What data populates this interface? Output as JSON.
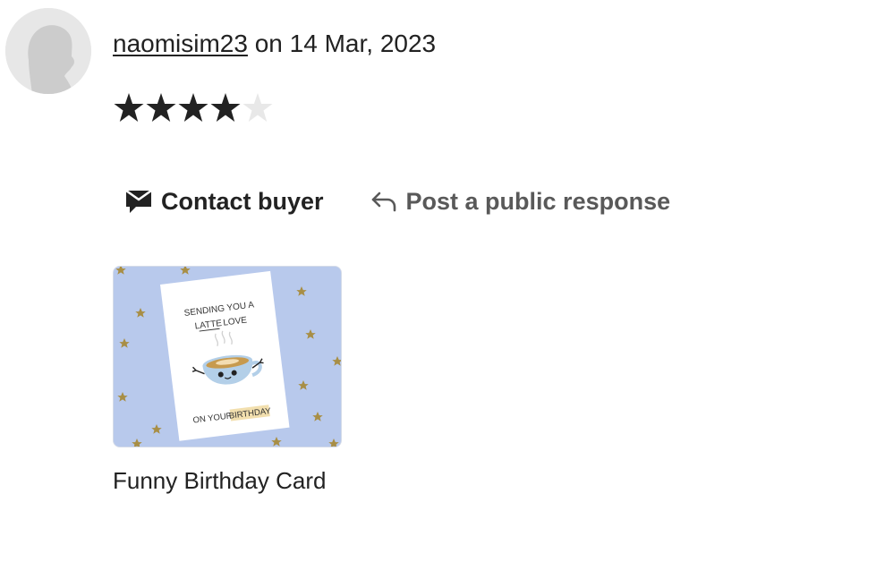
{
  "review": {
    "username": "naomisim23",
    "date_text": "on 14 Mar, 2023",
    "rating": 4,
    "rating_max": 5,
    "avatar_icon": "default-user-silhouette"
  },
  "actions": {
    "contact_label": "Contact buyer",
    "contact_icon": "envelope-icon",
    "respond_label": "Post a public response",
    "respond_icon": "reply-arrow-icon"
  },
  "product": {
    "title": "Funny Birthday Card",
    "card_line1": "SENDING YOU A",
    "card_line2_underlined": "LATTE",
    "card_line2_rest": "LOVE",
    "card_line3": "ON YOUR",
    "card_line3_highlight": "BIRTHDAY"
  },
  "colors": {
    "star_filled": "#222222",
    "star_empty": "#e8e8e8",
    "text_primary": "#222222",
    "text_secondary": "#595959",
    "thumb_background": "#b8c9ec",
    "gold_star": "#b89a4a"
  }
}
